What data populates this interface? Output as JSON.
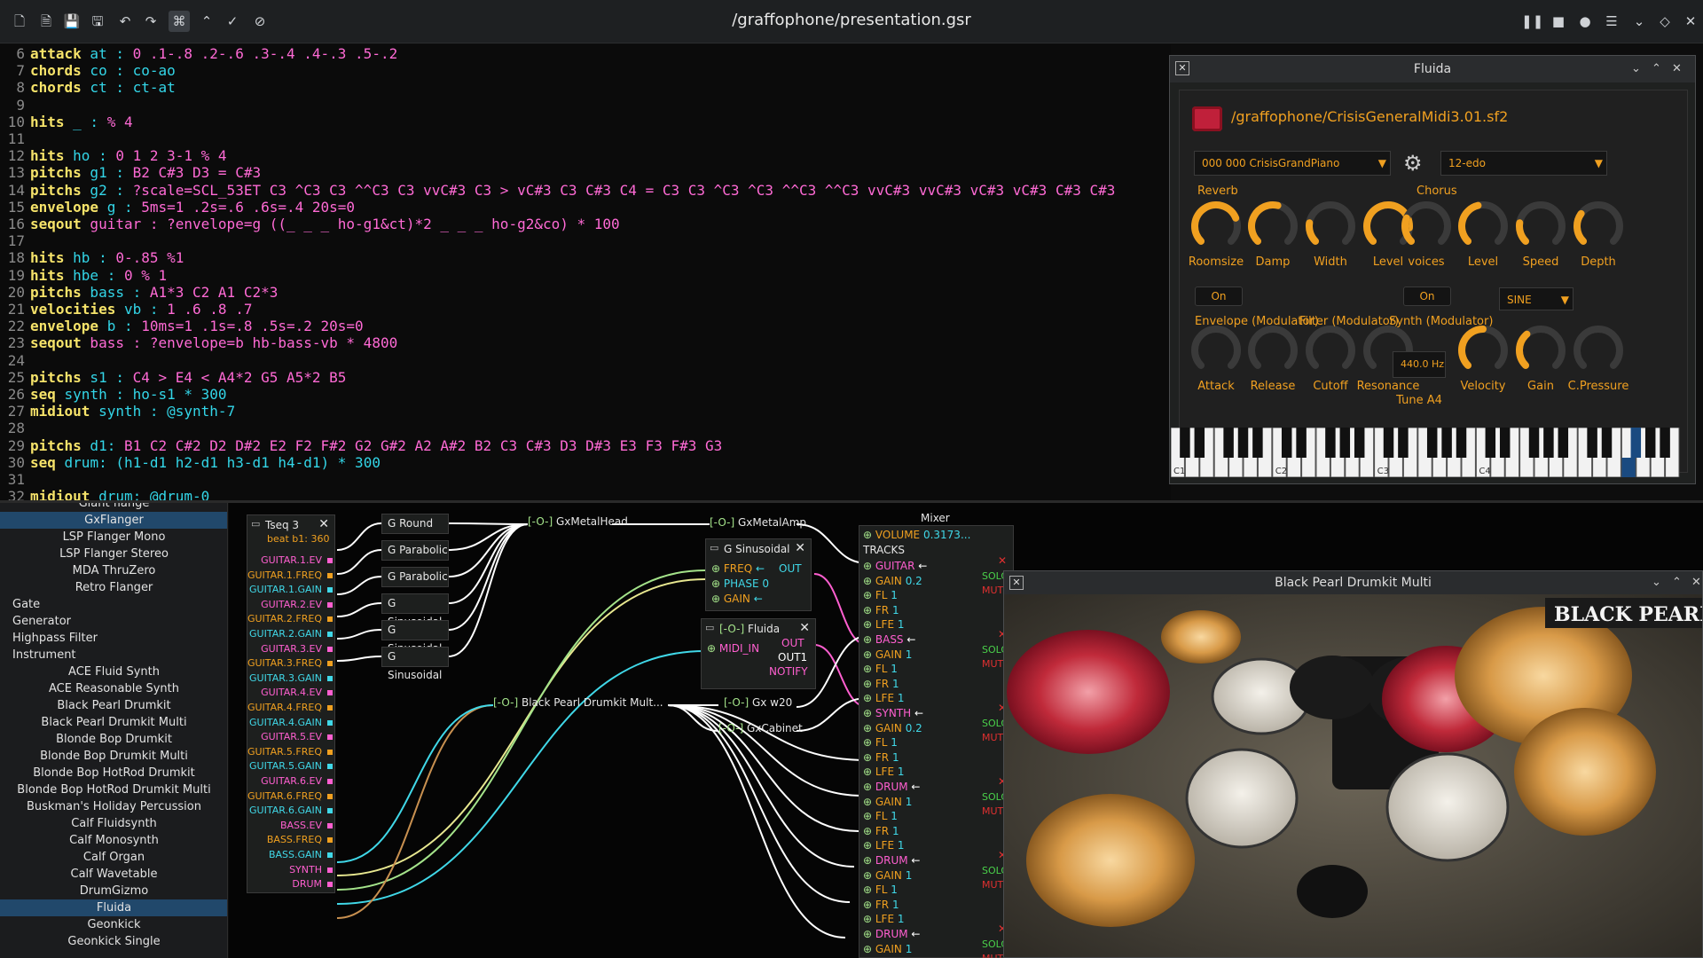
{
  "window": {
    "title": "/graffophone/presentation.gsr"
  },
  "editor": {
    "lines": [
      {
        "n": "6",
        "kw": "attack",
        "rest": [
          {
            "t": " at : ",
            "c": "cy"
          },
          {
            "t": "0 .1-.8 .2-.6 .3-.4 .4-.3 .5-.2",
            "c": "ex"
          }
        ]
      },
      {
        "n": "7",
        "kw": "chords",
        "rest": [
          {
            "t": " co : ",
            "c": "cy"
          },
          {
            "t": "co-ao",
            "c": "cy"
          }
        ]
      },
      {
        "n": "8",
        "kw": "chords",
        "rest": [
          {
            "t": " ct : ",
            "c": "cy"
          },
          {
            "t": "ct-at",
            "c": "cy"
          }
        ]
      },
      {
        "n": "9",
        "kw": "",
        "rest": []
      },
      {
        "n": "10",
        "kw": "hits",
        "rest": [
          {
            "t": " _ : ",
            "c": "cy"
          },
          {
            "t": "% 4",
            "c": "ex"
          }
        ]
      },
      {
        "n": "11",
        "kw": "",
        "rest": []
      },
      {
        "n": "12",
        "kw": "hits",
        "rest": [
          {
            "t": " ho : ",
            "c": "cy"
          },
          {
            "t": "0 1 2 3-1 % 4",
            "c": "ex"
          }
        ]
      },
      {
        "n": "13",
        "kw": "pitchs",
        "rest": [
          {
            "t": " g1 : ",
            "c": "cy"
          },
          {
            "t": "B2 C#3 D3 = C#3",
            "c": "ex"
          }
        ]
      },
      {
        "n": "14",
        "kw": "pitchs",
        "rest": [
          {
            "t": " g2 : ",
            "c": "cy"
          },
          {
            "t": "?scale=SCL_53ET C3 ^C3 C3 ^^C3 C3 vvC#3 C3 > vC#3 C3 C#3 C4 = C3 C3 ^C3 ^C3 ^^C3 ^^C3 vvC#3 vvC#3 vC#3 vC#3 C#3 C#3",
            "c": "ex"
          }
        ]
      },
      {
        "n": "15",
        "kw": "envelope",
        "rest": [
          {
            "t": " g : ",
            "c": "cy"
          },
          {
            "t": "5ms=1 .2s=.6 .6s=.4 20s=0",
            "c": "ex"
          }
        ]
      },
      {
        "n": "16",
        "kw": "seqout",
        "rest": [
          {
            "t": " guitar : ?envelope=g ((_ _ _ ho-g1&ct)*2 _ _ _ ho-g2&co) * 100",
            "c": "ex"
          }
        ]
      },
      {
        "n": "17",
        "kw": "",
        "rest": []
      },
      {
        "n": "18",
        "kw": "hits",
        "rest": [
          {
            "t": " hb : ",
            "c": "cy"
          },
          {
            "t": "0-.85 %1",
            "c": "ex"
          }
        ]
      },
      {
        "n": "19",
        "kw": "hits",
        "rest": [
          {
            "t": " hbe : ",
            "c": "cy"
          },
          {
            "t": "0 % 1",
            "c": "ex"
          }
        ]
      },
      {
        "n": "20",
        "kw": "pitchs",
        "rest": [
          {
            "t": " bass : ",
            "c": "cy"
          },
          {
            "t": "A1*3 C2 A1 C2*3",
            "c": "ex"
          }
        ]
      },
      {
        "n": "21",
        "kw": "velocities",
        "rest": [
          {
            "t": " vb : ",
            "c": "cy"
          },
          {
            "t": "1 .6 .8 .7",
            "c": "ex"
          }
        ]
      },
      {
        "n": "22",
        "kw": "envelope",
        "rest": [
          {
            "t": " b : ",
            "c": "cy"
          },
          {
            "t": "10ms=1 .1s=.8 .5s=.2 20s=0",
            "c": "ex"
          }
        ]
      },
      {
        "n": "23",
        "kw": "seqout",
        "rest": [
          {
            "t": " bass : ?envelope=b hb-bass-vb * 4800",
            "c": "ex"
          }
        ]
      },
      {
        "n": "24",
        "kw": "",
        "rest": []
      },
      {
        "n": "25",
        "kw": "pitchs",
        "rest": [
          {
            "t": " s1 : ",
            "c": "cy"
          },
          {
            "t": "C4 > E4 < A4*2 G5 A5*2 B5",
            "c": "ex"
          }
        ]
      },
      {
        "n": "26",
        "kw": "seq",
        "rest": [
          {
            "t": " synth : ho-s1 * 300",
            "c": "cy"
          }
        ]
      },
      {
        "n": "27",
        "kw": "midiout",
        "rest": [
          {
            "t": " synth : @synth-7",
            "c": "cy"
          }
        ]
      },
      {
        "n": "28",
        "kw": "",
        "rest": []
      },
      {
        "n": "29",
        "kw": "pitchs",
        "rest": [
          {
            "t": " d1: ",
            "c": "cy"
          },
          {
            "t": "B1 C2 C#2 D2 D#2 E2 F2 F#2 G2 G#2 A2 A#2 B2 C3 C#3 D3 D#3 E3 F3 F#3 G3",
            "c": "ex"
          }
        ]
      },
      {
        "n": "30",
        "kw": "seq",
        "rest": [
          {
            "t": " drum: (h1-d1 h2-d1 h3-d1 h4-d1) * 300",
            "c": "cy"
          }
        ]
      },
      {
        "n": "31",
        "kw": "",
        "rest": []
      },
      {
        "n": "32",
        "kw": "midiout",
        "rest": [
          {
            "t": " drum: @drum-0",
            "c": "cy"
          }
        ]
      }
    ]
  },
  "sidebar": {
    "items": [
      {
        "label": "Giant flange",
        "type": "item"
      },
      {
        "label": "GxFlanger",
        "type": "item",
        "selected": true
      },
      {
        "label": "LSP Flanger Mono",
        "type": "item"
      },
      {
        "label": "LSP Flanger Stereo",
        "type": "item"
      },
      {
        "label": "MDA ThruZero",
        "type": "item"
      },
      {
        "label": "Retro Flanger",
        "type": "item"
      },
      {
        "label": "Gate",
        "type": "cat"
      },
      {
        "label": "Generator",
        "type": "cat"
      },
      {
        "label": "Highpass Filter",
        "type": "cat"
      },
      {
        "label": "Instrument",
        "type": "cat"
      },
      {
        "label": "ACE Fluid Synth",
        "type": "item"
      },
      {
        "label": "ACE Reasonable Synth",
        "type": "item"
      },
      {
        "label": "Black Pearl Drumkit",
        "type": "item"
      },
      {
        "label": "Black Pearl Drumkit Multi",
        "type": "item"
      },
      {
        "label": "Blonde Bop Drumkit",
        "type": "item"
      },
      {
        "label": "Blonde Bop Drumkit Multi",
        "type": "item"
      },
      {
        "label": "Blonde Bop HotRod Drumkit",
        "type": "item"
      },
      {
        "label": "Blonde Bop HotRod Drumkit Multi",
        "type": "item"
      },
      {
        "label": "Buskman's Holiday Percussion",
        "type": "item"
      },
      {
        "label": "Calf Fluidsynth",
        "type": "item"
      },
      {
        "label": "Calf Monosynth",
        "type": "item"
      },
      {
        "label": "Calf Organ",
        "type": "item"
      },
      {
        "label": "Calf Wavetable",
        "type": "item"
      },
      {
        "label": "DrumGizmo",
        "type": "item"
      },
      {
        "label": "Fluida",
        "type": "item",
        "selected": true
      },
      {
        "label": "Geonkick",
        "type": "item"
      },
      {
        "label": "Geonkick Single",
        "type": "item"
      }
    ]
  },
  "graph": {
    "tseq": {
      "title": "Tseq 3",
      "beat": "beat b1: 360",
      "outputs": [
        {
          "l": "GUITAR.1.EV",
          "c": "#ff5fd0"
        },
        {
          "l": "GUITAR.1.FREQ",
          "c": "#f0a020"
        },
        {
          "l": "GUITAR.1.GAIN",
          "c": "#40d8e8"
        },
        {
          "l": "GUITAR.2.EV",
          "c": "#ff5fd0"
        },
        {
          "l": "GUITAR.2.FREQ",
          "c": "#f0a020"
        },
        {
          "l": "GUITAR.2.GAIN",
          "c": "#40d8e8"
        },
        {
          "l": "GUITAR.3.EV",
          "c": "#ff5fd0"
        },
        {
          "l": "GUITAR.3.FREQ",
          "c": "#f0a020"
        },
        {
          "l": "GUITAR.3.GAIN",
          "c": "#40d8e8"
        },
        {
          "l": "GUITAR.4.EV",
          "c": "#ff5fd0"
        },
        {
          "l": "GUITAR.4.FREQ",
          "c": "#f0a020"
        },
        {
          "l": "GUITAR.4.GAIN",
          "c": "#40d8e8"
        },
        {
          "l": "GUITAR.5.EV",
          "c": "#ff5fd0"
        },
        {
          "l": "GUITAR.5.FREQ",
          "c": "#f0a020"
        },
        {
          "l": "GUITAR.5.GAIN",
          "c": "#40d8e8"
        },
        {
          "l": "GUITAR.6.EV",
          "c": "#ff5fd0"
        },
        {
          "l": "GUITAR.6.FREQ",
          "c": "#f0a020"
        },
        {
          "l": "GUITAR.6.GAIN",
          "c": "#40d8e8"
        },
        {
          "l": "BASS.EV",
          "c": "#ff5fd0"
        },
        {
          "l": "BASS.FREQ",
          "c": "#f0a020"
        },
        {
          "l": "BASS.GAIN",
          "c": "#40d8e8"
        },
        {
          "l": "SYNTH",
          "c": "#ff5fd0"
        },
        {
          "l": "DRUM",
          "c": "#ff5fd0"
        }
      ]
    },
    "gen_nodes": [
      "G Round",
      "G Parabolic",
      "G Parabolic",
      "G Sinusoidal",
      "G Sinusoidal",
      "G Sinusoidal"
    ],
    "gxmetalhead": "GxMetalHead",
    "gxmetalamp": "GxMetalAmp",
    "gsin": {
      "title": "G Sinusoidal",
      "freq": "FREQ",
      "phase": "PHASE",
      "phase_val": "0",
      "gain": "GAIN",
      "out": "OUT"
    },
    "fluida_node": {
      "title": "Fluida",
      "midi_in": "MIDI_IN",
      "out": "OUT",
      "out1": "OUT1",
      "notify": "NOTIFY"
    },
    "drumkit_node": "Black Pearl Drumkit Mult...",
    "gxw20": "Gx w20",
    "gxcabinet": "GxCabinet",
    "o_tag": "[-O-]",
    "mixer": {
      "title": "Mixer",
      "volume_label": "VOLUME",
      "volume_value": "0.3173...",
      "tracks_label": "TRACKS",
      "tracks": [
        {
          "name": "GUITAR",
          "gain": "0.2",
          "fl": "1",
          "fr": "1",
          "lfe": "1"
        },
        {
          "name": "BASS",
          "gain": "1",
          "fl": "1",
          "fr": "1",
          "lfe": "1"
        },
        {
          "name": "SYNTH",
          "gain": "0.2",
          "fl": "1",
          "fr": "1",
          "lfe": "1"
        },
        {
          "name": "DRUM",
          "gain": "1",
          "fl": "1",
          "fr": "1",
          "lfe": "1"
        },
        {
          "name": "DRUM",
          "gain": "1",
          "fl": "1",
          "fr": "1",
          "lfe": "1"
        },
        {
          "name": "DRUM",
          "gain": "1",
          "fl": "",
          "fr": "",
          "lfe": ""
        }
      ],
      "gain_label": "GAIN",
      "fl_label": "FL",
      "fr_label": "FR",
      "lfe_label": "LFE",
      "solo": "SOLO",
      "mute": "MUTE"
    }
  },
  "fluida": {
    "title": "Fluida",
    "path": "/graffophone/CrisisGeneralMidi3.01.sf2",
    "preset": "000 000 CrisisGrandPiano",
    "tuning": "12-edo",
    "reverb_label": "Reverb",
    "chorus_label": "Chorus",
    "reverb_knobs": [
      {
        "l": "Roomsize",
        "v": 0.75
      },
      {
        "l": "Damp",
        "v": 0.55
      },
      {
        "l": "Width",
        "v": 0.2
      },
      {
        "l": "Level",
        "v": 0.85
      }
    ],
    "chorus_knobs": [
      {
        "l": "voices",
        "v": 0.25
      },
      {
        "l": "Level",
        "v": 0.45
      },
      {
        "l": "Speed",
        "v": 0.2
      },
      {
        "l": "Depth",
        "v": 0.3
      }
    ],
    "reverb_on": "On",
    "chorus_on": "On",
    "waveform": "SINE",
    "env_label": "Envelope (Modulator)",
    "filter_label": "Filter (Modulator)",
    "synth_label": "Synth (Modulator)",
    "bottom_knobs": [
      {
        "l": "Attack",
        "v": 0
      },
      {
        "l": "Release",
        "v": 0
      },
      {
        "l": "Cutoff",
        "v": 0
      },
      {
        "l": "Resonance",
        "v": 0
      }
    ],
    "tune_value": "440.0 Hz",
    "tune_label": "Tune A4",
    "synth_knobs": [
      {
        "l": "Velocity",
        "v": 0.5
      },
      {
        "l": "Gain",
        "v": 0.35
      },
      {
        "l": "C.Pressure",
        "v": 0
      }
    ],
    "octaves": [
      "C1",
      "C2",
      "C3",
      "C4"
    ]
  },
  "drumwin": {
    "title": "Black Pearl Drumkit Multi",
    "brand": "BLACK PEARL"
  },
  "colors": {
    "accent": "#f0a020",
    "sel": "#21486b",
    "pink": "#ff5fd0",
    "cyan": "#40d8e8"
  }
}
